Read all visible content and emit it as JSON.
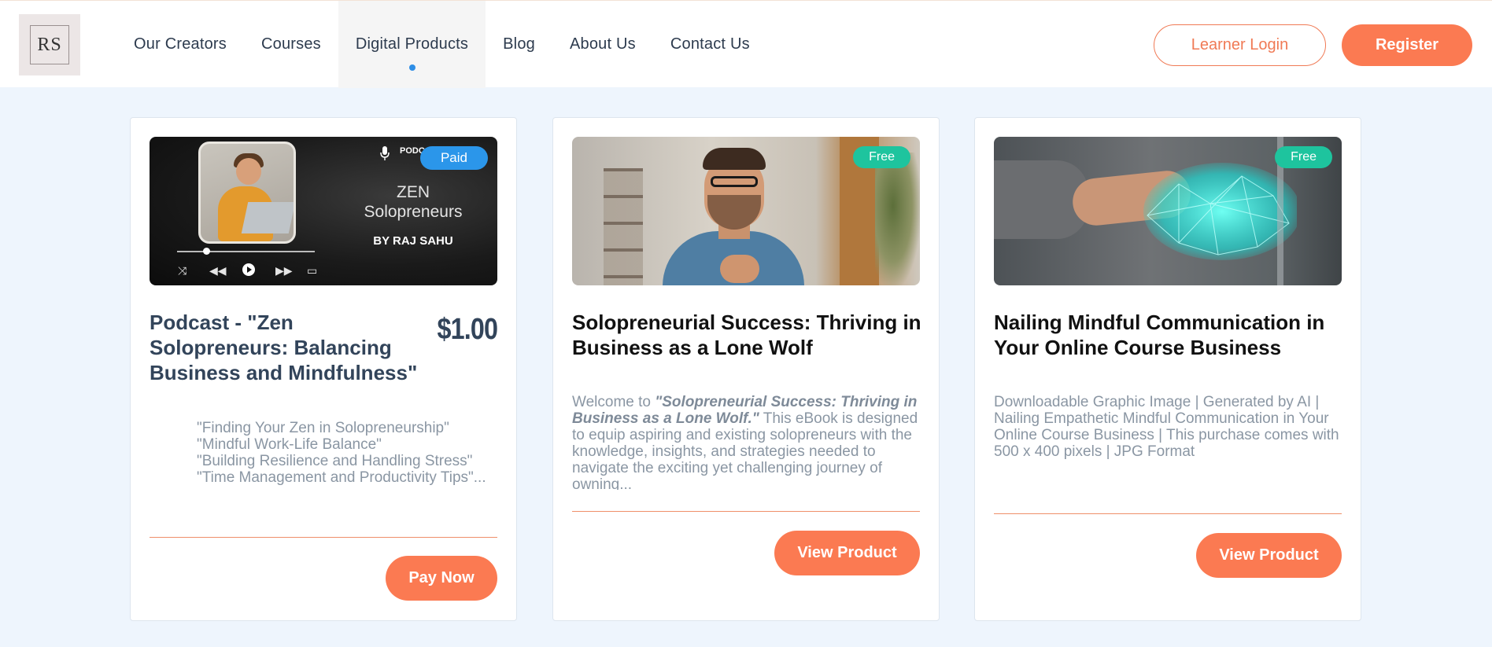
{
  "logo": {
    "text": "RS"
  },
  "nav": [
    {
      "label": "Our Creators"
    },
    {
      "label": "Courses"
    },
    {
      "label": "Digital Products",
      "active": true
    },
    {
      "label": "Blog"
    },
    {
      "label": "About Us"
    },
    {
      "label": "Contact Us"
    }
  ],
  "header": {
    "login_label": "Learner Login",
    "register_label": "Register"
  },
  "colors": {
    "accent": "#fb7a52",
    "paid_badge": "#2b96ea",
    "free_badge": "#1ec49e",
    "active_dot": "#2e8ee6"
  },
  "products": [
    {
      "badge": "Paid",
      "title": "Podcast - \"Zen Solopreneurs: Balancing Business and Mindfulness\"",
      "price": "$1.00",
      "desc_lines": [
        "\"Finding Your Zen in Solopreneurship\"",
        "\"Mindful Work-Life Balance\"",
        "\"Building Resilience and Handling Stress\"",
        "\"Time Management and Productivity Tips\"..."
      ],
      "cta": "Pay Now",
      "thumb": {
        "label": "PODCAST",
        "title_line1": "ZEN",
        "title_line2": "Solopreneurs",
        "byline": "BY RAJ SAHU"
      }
    },
    {
      "badge": "Free",
      "title": "Solopreneurial Success: Thriving in Business as a Lone Wolf",
      "desc_prefix": "Welcome to ",
      "desc_emphasis": "\"Solopreneurial Success: Thriving in Business as a Lone Wolf.\"",
      "desc_rest": " This eBook is designed to equip aspiring and existing solopreneurs with the knowledge, insights, and strategies needed to navigate the exciting yet challenging journey of owning...",
      "cta": "View Product"
    },
    {
      "badge": "Free",
      "title": "Nailing Mindful Communication in Your Online Course Business",
      "desc": "Downloadable Graphic Image | Generated by AI | Nailing Empathetic Mindful Communication in Your Online Course Business | This purchase comes with 500 x 400 pixels | JPG Format",
      "cta": "View Product"
    }
  ]
}
